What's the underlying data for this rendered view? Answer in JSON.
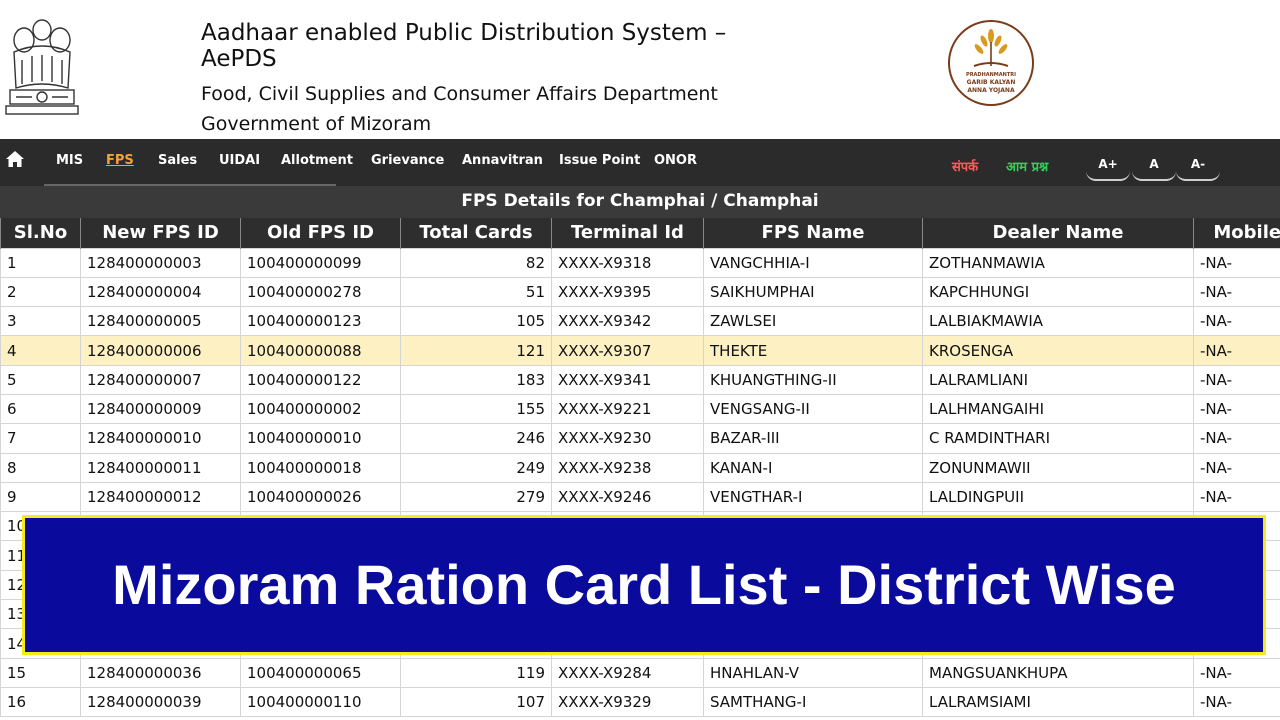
{
  "header": {
    "title_line1": "Aadhaar enabled Public Distribution System –",
    "title_line2": "AePDS",
    "department": "Food, Civil Supplies and Consumer Affairs Department",
    "government": "Government of Mizoram",
    "emblem_icon": "national-emblem-icon",
    "pmgkay_logo_text": "PRADHANMANTRI GARIB KALYAN ANNA YOJANA"
  },
  "nav": {
    "items": [
      "MIS",
      "FPS",
      "Sales",
      "UIDAI",
      "Allotment",
      "Grievance",
      "Annavitran",
      "Issue Point",
      "ONOR"
    ],
    "active": "FPS",
    "contact": "संपर्क",
    "faq": "आम प्रश्न",
    "font_increase": "A+",
    "font_normal": "A",
    "font_decrease": "A-"
  },
  "table": {
    "caption": "FPS Details for Champhai / Champhai",
    "headers": [
      "Sl.No",
      "New FPS ID",
      "Old FPS ID",
      "Total Cards",
      "Terminal Id",
      "FPS Name",
      "Dealer Name",
      "Mobile"
    ],
    "rows": [
      [
        "1",
        "128400000003",
        "100400000099",
        "82",
        "XXXX-X9318",
        "VANGCHHIA-I",
        "ZOTHANMAWIA",
        "-NA-"
      ],
      [
        "2",
        "128400000004",
        "100400000278",
        "51",
        "XXXX-X9395",
        "SAIKHUMPHAI",
        "KAPCHHUNGI",
        "-NA-"
      ],
      [
        "3",
        "128400000005",
        "100400000123",
        "105",
        "XXXX-X9342",
        "ZAWLSEI",
        "LALBIAKMAWIA",
        "-NA-"
      ],
      [
        "4",
        "128400000006",
        "100400000088",
        "121",
        "XXXX-X9307",
        "THEKTE",
        "KROSENGA",
        "-NA-"
      ],
      [
        "5",
        "128400000007",
        "100400000122",
        "183",
        "XXXX-X9341",
        "KHUANGTHING-II",
        "LALRAMLIANI",
        "-NA-"
      ],
      [
        "6",
        "128400000009",
        "100400000002",
        "155",
        "XXXX-X9221",
        "VENGSANG-II",
        "LALHMANGAIHI",
        "-NA-"
      ],
      [
        "7",
        "128400000010",
        "100400000010",
        "246",
        "XXXX-X9230",
        "BAZAR-III",
        "C RAMDINTHARI",
        "-NA-"
      ],
      [
        "8",
        "128400000011",
        "100400000018",
        "249",
        "XXXX-X9238",
        "KANAN-I",
        "ZONUNMAWII",
        "-NA-"
      ],
      [
        "9",
        "128400000012",
        "100400000026",
        "279",
        "XXXX-X9246",
        "VENGTHAR-I",
        "LALDINGPUII",
        "-NA-"
      ],
      [
        "10",
        "",
        "",
        "",
        "",
        "",
        "",
        ""
      ],
      [
        "11",
        "",
        "",
        "",
        "",
        "",
        "",
        ""
      ],
      [
        "12",
        "",
        "",
        "",
        "",
        "",
        "",
        ""
      ],
      [
        "13",
        "",
        "",
        "",
        "",
        "",
        "",
        ""
      ],
      [
        "14",
        "",
        "",
        "",
        "",
        "",
        "",
        ""
      ],
      [
        "15",
        "128400000036",
        "100400000065",
        "119",
        "XXXX-X9284",
        "HNAHLAN-V",
        "MANGSUANKHUPA",
        "-NA-"
      ],
      [
        "16",
        "128400000039",
        "100400000110",
        "107",
        "XXXX-X9329",
        "SAMTHANG-I",
        "LALRAMSIAMI",
        "-NA-"
      ]
    ],
    "highlighted_row": 3
  },
  "banner": {
    "text": "Mizoram Ration Card List - District Wise"
  },
  "colors": {
    "nav_bg": "#2b2b2b",
    "active_nav": "#f2a33a",
    "highlight_row": "#fdf1c3",
    "banner_bg": "#0a0a9c",
    "banner_border": "#f5ea1a"
  }
}
